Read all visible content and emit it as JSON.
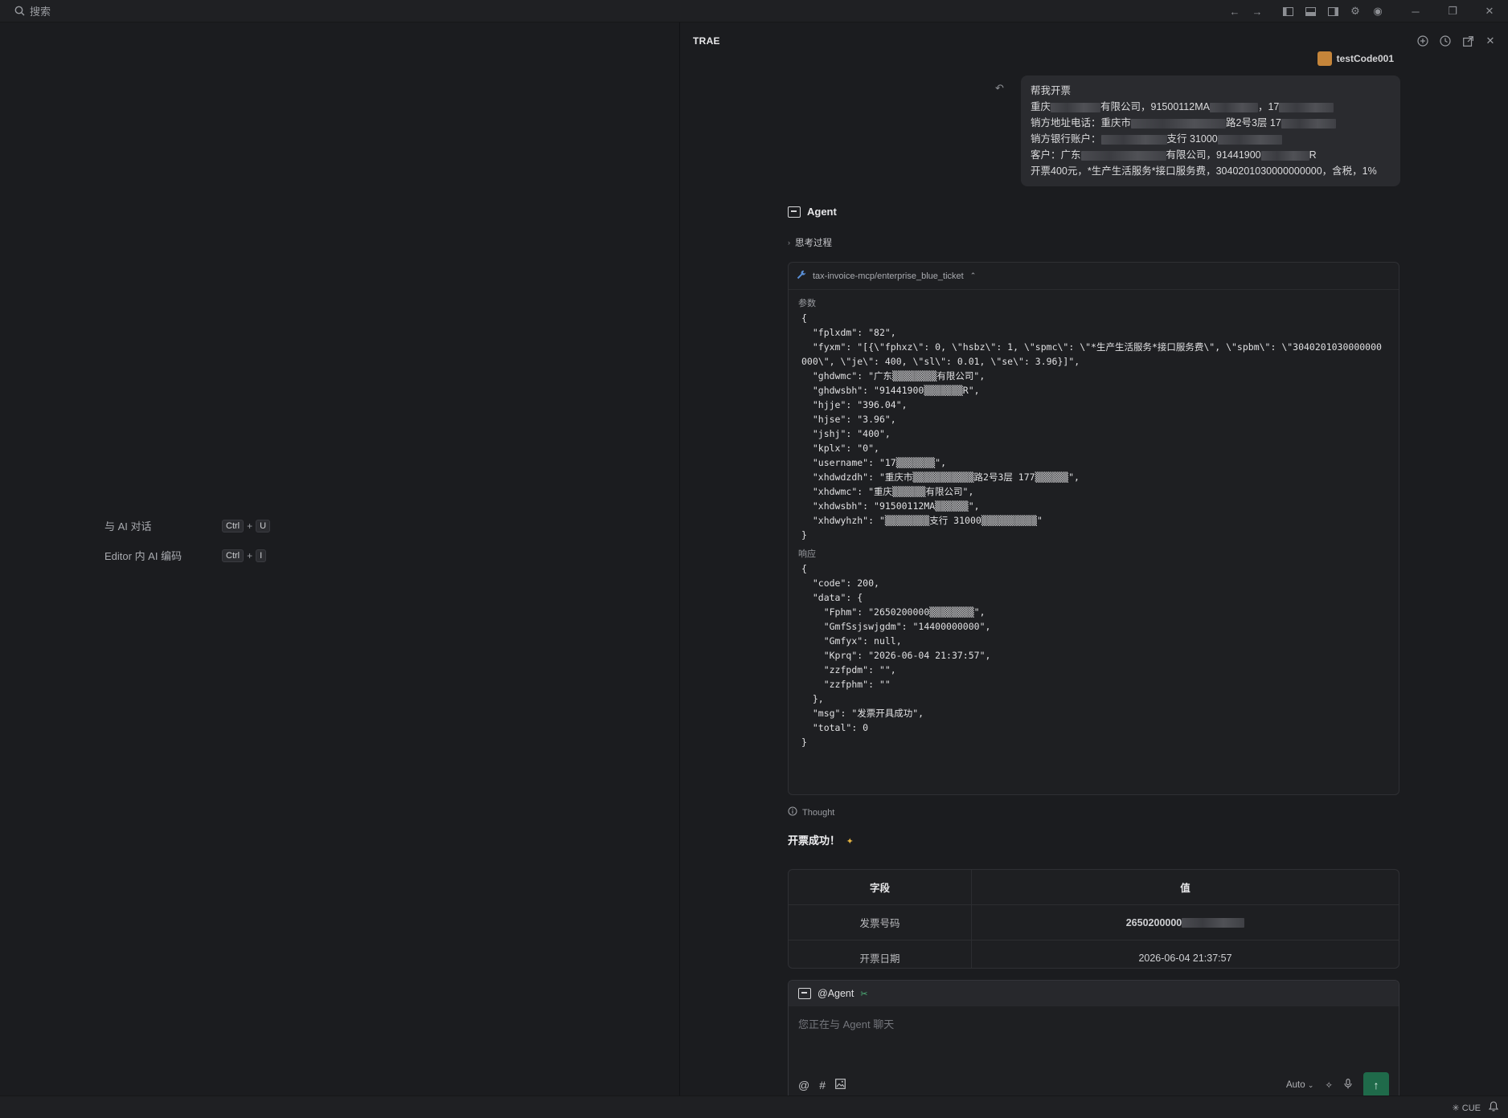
{
  "titlebar": {
    "search_placeholder": "搜索",
    "icons": [
      "arrow-left-icon",
      "arrow-right-icon",
      "toggle-left-panel-icon",
      "toggle-bottom-panel-icon",
      "toggle-right-panel-icon",
      "settings-icon",
      "account-icon"
    ],
    "window_controls": [
      "minimize-icon",
      "restore-icon",
      "close-icon"
    ]
  },
  "editor": {
    "shortcuts": [
      {
        "label": "与 AI 对话",
        "key1": "Ctrl",
        "plus": "+",
        "key2": "U"
      },
      {
        "label": "Editor 内 AI 编码",
        "key1": "Ctrl",
        "plus": "+",
        "key2": "I"
      }
    ]
  },
  "panel": {
    "title": "TRAE",
    "header_icons": [
      "new-chat-icon",
      "history-icon",
      "pop-out-icon",
      "close-icon"
    ],
    "user_name": "testCode001",
    "user_message": {
      "title": "帮我开票",
      "lines": [
        {
          "pre": "重庆",
          "mid": "有限公司，91500112MA",
          "mid2": "，17",
          "post": ""
        },
        {
          "pre": "销方地址电话：重庆市",
          "mid": "路2号3层 17",
          "mid2": "",
          "post": ""
        },
        {
          "pre": "销方银行账户：",
          "mid": "支行 31000",
          "mid2": "",
          "post": ""
        },
        {
          "pre": "客户：广东",
          "mid": "有限公司，91441900",
          "mid2": "R",
          "post": ""
        },
        {
          "pre": "开票400元，*生产生活服务*接口服务费，3040201030000000000，含税，1%",
          "mid": "",
          "mid2": "",
          "post": ""
        }
      ]
    },
    "agent_label": "Agent",
    "thinking_label": "思考过程",
    "tool_call": {
      "name": "tax-invoice-mcp/enterprise_blue_ticket",
      "params_label": "参数",
      "params_lines": [
        "{",
        "  \"fplxdm\": \"82\",",
        "  \"fyxm\": \"[{\\\"fphxz\\\": 0, \\\"hsbz\\\": 1, \\\"spmc\\\": \\\"*生产生活服务*接口服务费\\\", \\\"spbm\\\": \\\"3040201030000000000\\\", \\\"je\\\": 400, \\\"sl\\\": 0.01, \\\"se\\\": 3.96}]\",",
        "  \"ghdwmc\": \"广东▒▒▒▒▒▒▒▒有限公司\",",
        "  \"ghdwsbh\": \"91441900▒▒▒▒▒▒▒R\",",
        "  \"hjje\": \"396.04\",",
        "  \"hjse\": \"3.96\",",
        "  \"jshj\": \"400\",",
        "  \"kplx\": \"0\",",
        "  \"username\": \"17▒▒▒▒▒▒▒\",",
        "  \"xhdwdzdh\": \"重庆市▒▒▒▒▒▒▒▒▒▒▒路2号3层 177▒▒▒▒▒▒\",",
        "  \"xhdwmc\": \"重庆▒▒▒▒▒▒有限公司\",",
        "  \"xhdwsbh\": \"91500112MA▒▒▒▒▒▒\",",
        "  \"xhdwyhzh\": \"▒▒▒▒▒▒▒▒支行 31000▒▒▒▒▒▒▒▒▒▒\"",
        "}"
      ],
      "response_label": "响应",
      "response_lines": [
        "{",
        "  \"code\": 200,",
        "  \"data\": {",
        "    \"Fphm\": \"2650200000▒▒▒▒▒▒▒▒\",",
        "    \"GmfSsjswjgdm\": \"14400000000\",",
        "    \"Gmfyx\": null,",
        "    \"Kprq\": \"2026-06-04 21:37:57\",",
        "    \"zzfpdm\": \"\",",
        "    \"zzfphm\": \"\"",
        "  },",
        "  \"msg\": \"发票开具成功\",",
        "  \"total\": 0",
        "}"
      ]
    },
    "thought_label": "Thought",
    "success_text": "开票成功！",
    "table": {
      "headers": [
        "字段",
        "值"
      ],
      "rows": [
        [
          "发票号码",
          "2650200000"
        ],
        [
          "开票日期",
          "2026-06-04 21:37:57"
        ]
      ]
    },
    "composer": {
      "agent_tag": "@Agent",
      "placeholder": "您正在与 Agent 聊天",
      "mode": "Auto",
      "tool_icons": [
        "at-icon",
        "hash-icon",
        "image-icon"
      ]
    }
  },
  "statusbar": {
    "right_text": "CUE"
  },
  "colors": {
    "background": "#1b1c1f",
    "accent_send": "#1f6a4a",
    "tool_icon": "#5a8fd6"
  }
}
